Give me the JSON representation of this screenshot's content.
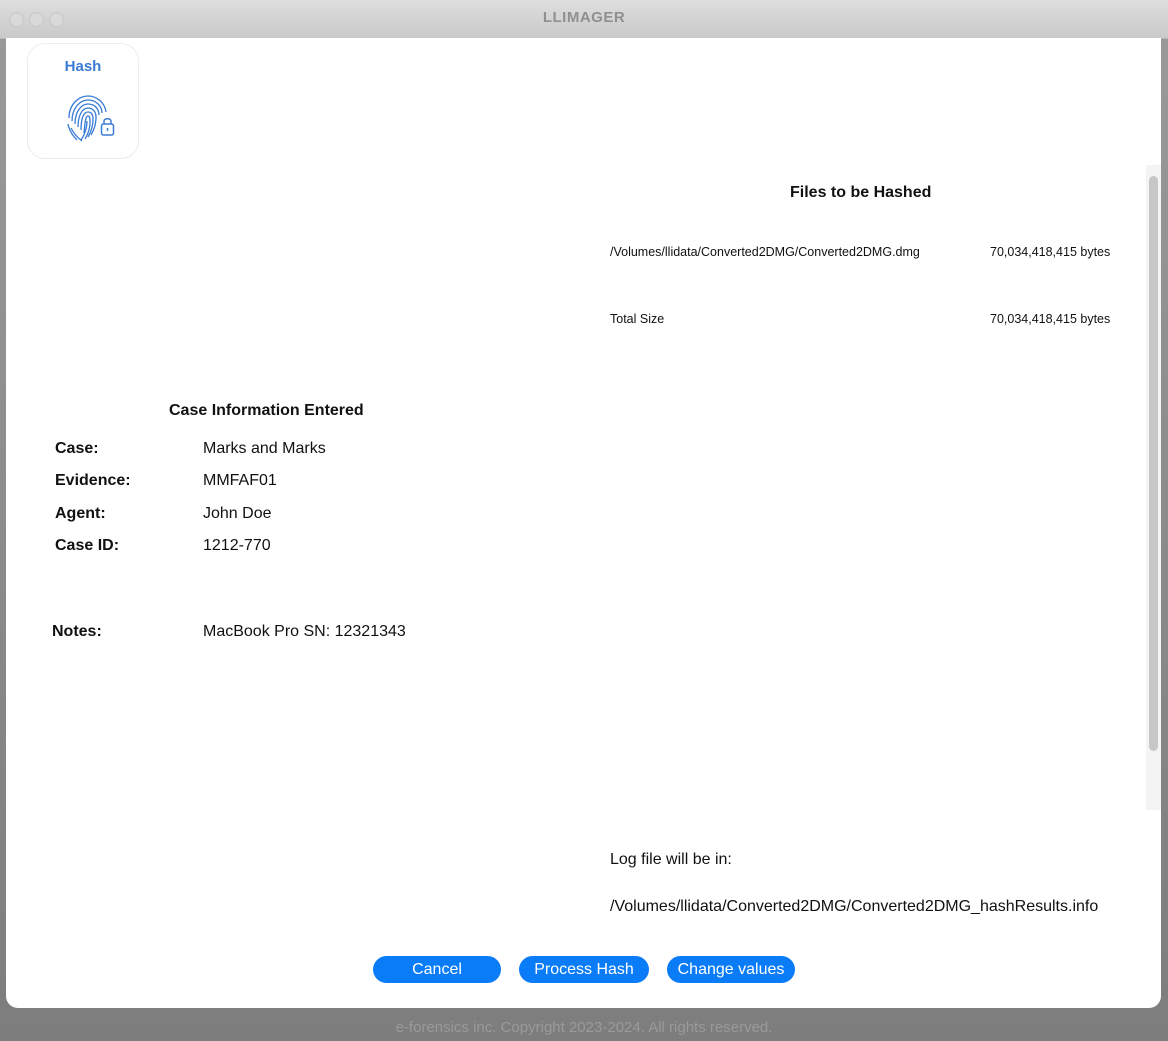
{
  "window": {
    "title": "LLIMAGER"
  },
  "app_icon": {
    "label": "Hash",
    "icon": "fingerprint-lock-icon"
  },
  "files": {
    "heading": "Files to be Hashed",
    "rows": [
      {
        "path": "/Volumes/llidata/Converted2DMG/Converted2DMG.dmg",
        "size": "70,034,418,415 bytes"
      }
    ],
    "total": {
      "label": "Total Size",
      "size": "70,034,418,415 bytes"
    }
  },
  "case": {
    "heading": "Case Information Entered",
    "fields": [
      {
        "label": "Case:",
        "value": "Marks and Marks"
      },
      {
        "label": "Evidence:",
        "value": "MMFAF01"
      },
      {
        "label": "Agent:",
        "value": "John Doe"
      },
      {
        "label": "Case ID:",
        "value": "1212-770"
      }
    ],
    "notes": {
      "label": "Notes:",
      "value": "MacBook Pro SN: 12321343"
    }
  },
  "log": {
    "label": "Log file will be in:",
    "path": "/Volumes/llidata/Converted2DMG/Converted2DMG_hashResults.info"
  },
  "buttons": {
    "cancel": "Cancel",
    "process": "Process Hash",
    "change": "Change values"
  },
  "footer": "e-forensics inc. Copyright 2023-2024. All rights reserved.",
  "colors": {
    "accent": "#0a7cf7",
    "icon_blue": "#3a7bd5"
  }
}
